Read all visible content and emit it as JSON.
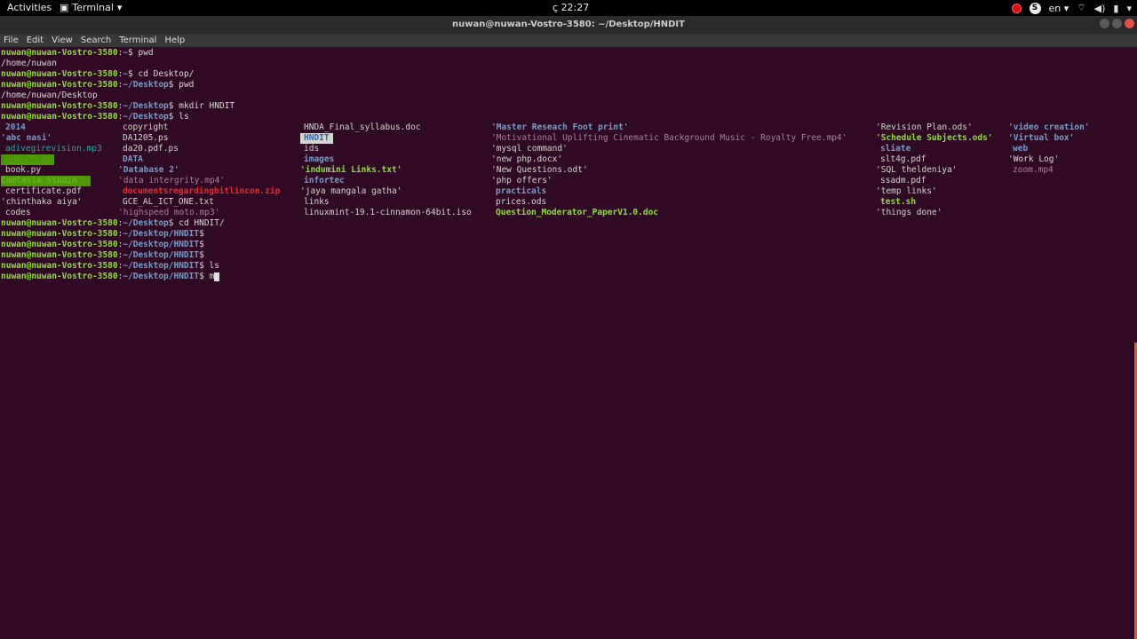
{
  "topbar": {
    "activities": "Activities",
    "app_name": "Terminal",
    "clock": "22:27",
    "clock_prefix": "ç",
    "lang": "en"
  },
  "window": {
    "title": "nuwan@nuwan-Vostro-3580: ~/Desktop/HNDIT"
  },
  "menu": [
    "File",
    "Edit",
    "View",
    "Search",
    "Terminal",
    "Help"
  ],
  "prompt": {
    "user_host": "nuwan@nuwan-Vostro-3580",
    "home": "~",
    "desktop": "~/Desktop",
    "hndit": "~/Desktop/HNDIT"
  },
  "history": {
    "cmd1": "pwd",
    "out1": "/home/nuwan",
    "cmd2": "cd Desktop/",
    "cmd3": "pwd",
    "out3": "/home/nuwan/Desktop",
    "cmd4": "mkdir HNDIT",
    "cmd5": "ls",
    "cmd6": "cd HNDIT/",
    "cmd10": "ls",
    "current_input": "m"
  },
  "ls_output": {
    "col1": [
      "2014",
      "'abc nasi'",
      "adivegirevision.mp3",
      "bit.coin",
      "book.py",
      "Camtasia Studio",
      "certificate.pdf",
      "'chinthaka aiya'",
      "codes"
    ],
    "col2": [
      "copyright",
      "DA1205.ps",
      "da20.pdf.ps",
      "DATA",
      "'Database 2'",
      "'data intergrity.mp4'",
      "documentsregardingbitlincon.zip",
      "GCE_AL_ICT_ONE.txt",
      "'highspeed moto.mp3'"
    ],
    "col3": [
      "HNDA_Final_syllabus.doc",
      "HNDIT",
      "ids",
      "images",
      "'indumini Links.txt'",
      "infortec",
      "'jaya mangala gatha'",
      "links",
      "linuxmint-19.1-cinnamon-64bit.iso"
    ],
    "col4": [
      "'Master Reseach Foot print'",
      "'Motivational Uplifting Cinematic Background Music - Royalty Free.mp4'",
      "'mysql command'",
      "'new php.docx'",
      "'New Questions.odt'",
      "'php offers'",
      "practicals",
      "prices.ods",
      "Question_Moderator_PaperV1.0.doc"
    ],
    "col5": [
      "'Revision Plan.ods'",
      "'Schedule Subjects.ods'",
      "sliate",
      "slt4g.pdf",
      "'SQL theldeniya'",
      "ssadm.pdf",
      "'temp links'",
      "test.sh",
      "'things done'"
    ],
    "col6": [
      "'video creation'",
      "'Virtual box'",
      "web",
      "'Work Log'",
      "zoom.mp4"
    ]
  }
}
